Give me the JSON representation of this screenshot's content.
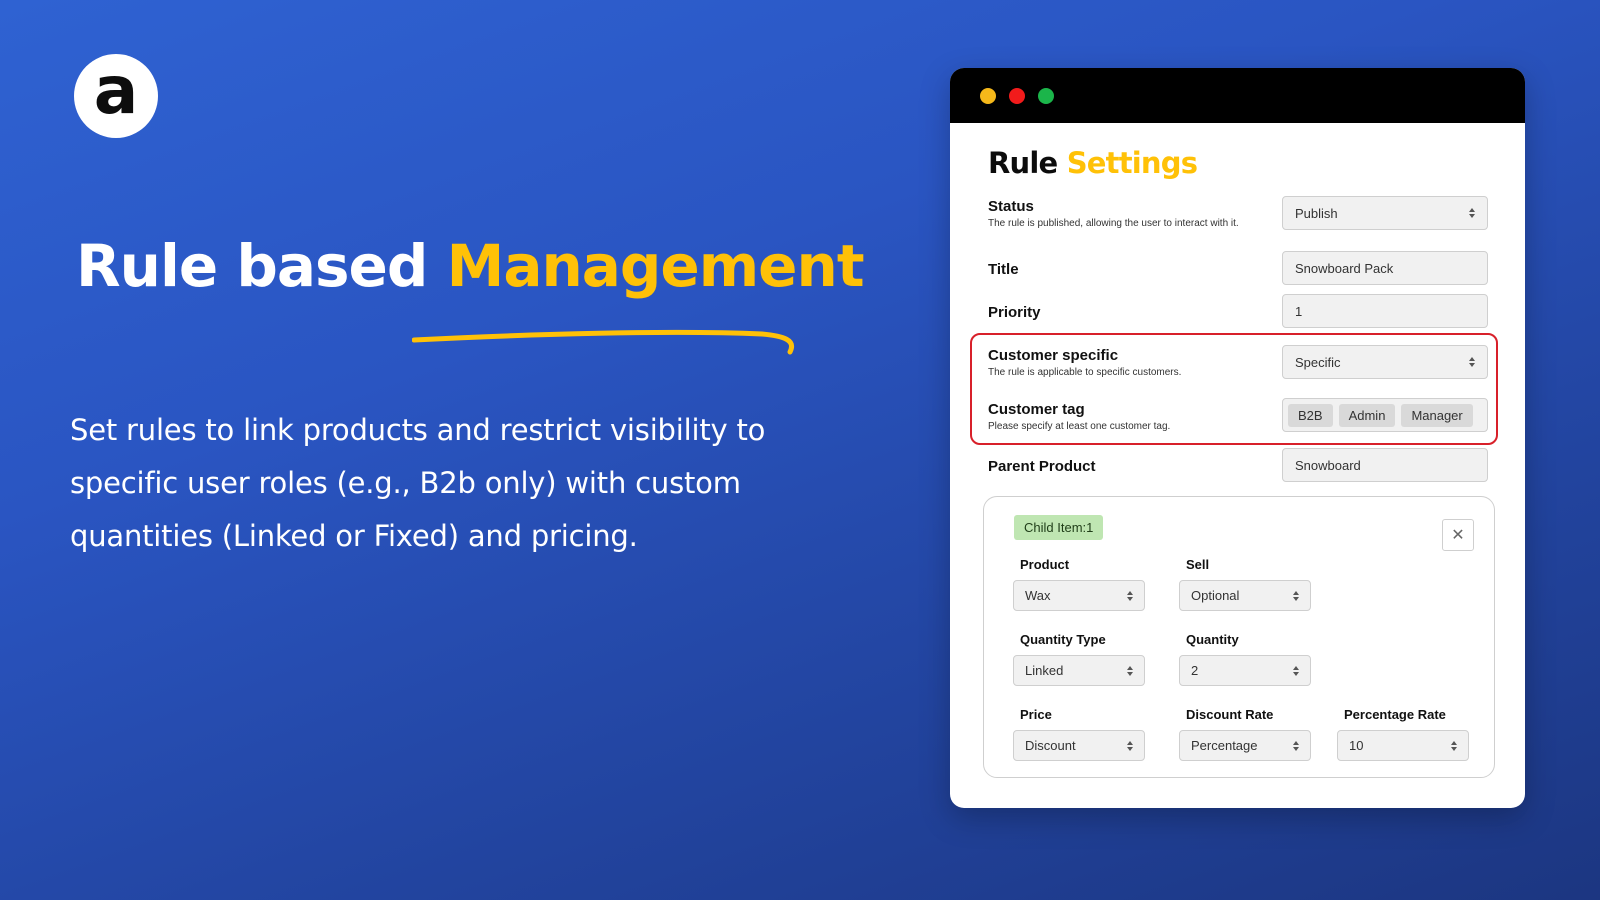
{
  "promo": {
    "logo_letter": "a",
    "headline_plain": "Rule based",
    "headline_accent": "Management",
    "description": "Set rules to link products and restrict visibility to specific user roles (e.g., B2b only) with custom quantities (Linked or Fixed) and pricing."
  },
  "colors": {
    "accent": "#ffc107",
    "highlight_border": "#d8202a",
    "badge_bg": "#bfe6b2"
  },
  "panel": {
    "title_plain": "Rule",
    "title_accent": "Settings",
    "status": {
      "label": "Status",
      "hint": "The rule is published, allowing the user to interact with it.",
      "value": "Publish"
    },
    "title_field": {
      "label": "Title",
      "value": "Snowboard Pack"
    },
    "priority": {
      "label": "Priority",
      "value": "1"
    },
    "customer_specific": {
      "label": "Customer specific",
      "hint": "The rule is applicable to specific customers.",
      "value": "Specific"
    },
    "customer_tag": {
      "label": "Customer tag",
      "hint": "Please specify at least one customer tag.",
      "tags": [
        "B2B",
        "Admin",
        "Manager"
      ]
    },
    "parent_product": {
      "label": "Parent Product",
      "value": "Snowboard"
    },
    "child": {
      "badge": "Child Item:1",
      "close_glyph": "✕",
      "product": {
        "label": "Product",
        "value": "Wax"
      },
      "sell": {
        "label": "Sell",
        "value": "Optional"
      },
      "quantity_type": {
        "label": "Quantity Type",
        "value": "Linked"
      },
      "quantity": {
        "label": "Quantity",
        "value": "2"
      },
      "price": {
        "label": "Price",
        "value": "Discount"
      },
      "discount_rate": {
        "label": "Discount Rate",
        "value": "Percentage"
      },
      "percentage_rate": {
        "label": "Percentage Rate",
        "value": "10"
      }
    }
  }
}
